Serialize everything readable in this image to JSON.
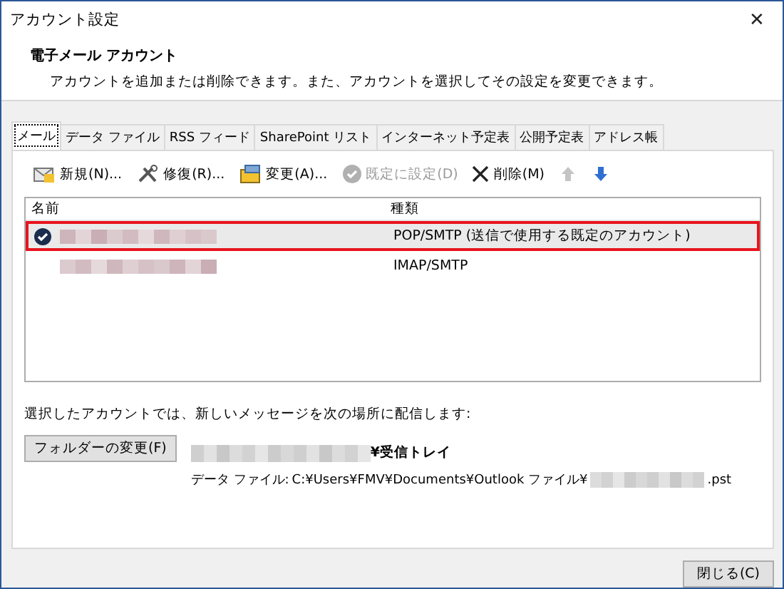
{
  "window": {
    "title": "アカウント設定",
    "close": "✕"
  },
  "header": {
    "title": "電子メール アカウント",
    "description": "アカウントを追加または削除できます。また、アカウントを選択してその設定を変更できます。"
  },
  "tabs": [
    {
      "label": "メール",
      "selected": true
    },
    {
      "label": "データ ファイル",
      "selected": false
    },
    {
      "label": "RSS フィード",
      "selected": false
    },
    {
      "label": "SharePoint リスト",
      "selected": false
    },
    {
      "label": "インターネット予定表",
      "selected": false
    },
    {
      "label": "公開予定表",
      "selected": false
    },
    {
      "label": "アドレス帳",
      "selected": false
    }
  ],
  "toolbar": [
    {
      "kind": "new",
      "label": "新規(N)...",
      "disabled": false
    },
    {
      "kind": "repair",
      "label": "修復(R)...",
      "disabled": false
    },
    {
      "kind": "change",
      "label": "変更(A)...",
      "disabled": false
    },
    {
      "kind": "default",
      "label": "既定に設定(D)",
      "disabled": true
    },
    {
      "kind": "delete",
      "label": "削除(M)",
      "disabled": false
    },
    {
      "kind": "up",
      "disabled": true
    },
    {
      "kind": "down",
      "disabled": false
    }
  ],
  "accounts": {
    "columns": [
      "名前",
      "種類"
    ],
    "rows": [
      {
        "type": "POP/SMTP (送信で使用する既定のアカウント)",
        "default": true,
        "selected": true
      },
      {
        "type": "IMAP/SMTP",
        "default": false,
        "selected": false
      }
    ]
  },
  "delivery": {
    "label": "選択したアカウントでは、新しいメッセージを次の場所に配信します:",
    "button": "フォルダーの変更(F)",
    "folder": "¥受信トレイ",
    "data_file_label": "データ ファイル:",
    "data_file_path": "C:¥Users¥FMV¥Documents¥Outlook ファイル¥",
    "data_file_ext": ".pst"
  },
  "buttons": [
    "閉じる(C)"
  ]
}
